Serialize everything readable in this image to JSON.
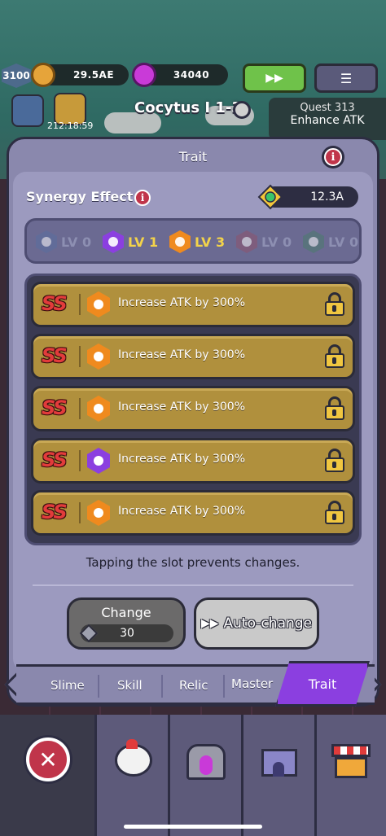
{
  "hud": {
    "level": "3100",
    "gold": "29.5AE",
    "gems": "34040",
    "timer": "212:18:59",
    "stage_title": "Cocytus I 1-3",
    "quest_title": "Quest 313",
    "quest_desc": "Enhance ATK"
  },
  "panel": {
    "title": "Trait",
    "synergy_label": "Synergy Effect",
    "synergy_value": "12.3A",
    "levels": [
      {
        "label": "LV 0",
        "color": "#5a6f9e",
        "active": false
      },
      {
        "label": "LV 1",
        "color": "#8b3fe0",
        "active": true
      },
      {
        "label": "LV 3",
        "color": "#ef8a1e",
        "active": true
      },
      {
        "label": "LV 0",
        "color": "#8a5570",
        "active": false
      },
      {
        "label": "LV 0",
        "color": "#4e7a70",
        "active": false
      }
    ],
    "slots": [
      {
        "grade": "SS",
        "text": "Increase ATK by 300%",
        "color": "#ef8a1e"
      },
      {
        "grade": "SS",
        "text": "Increase ATK by 300%",
        "color": "#ef8a1e"
      },
      {
        "grade": "SS",
        "text": "Increase ATK by 300%",
        "color": "#ef8a1e"
      },
      {
        "grade": "SS",
        "text": "Increase ATK by 300%",
        "color": "#8b3fe0"
      },
      {
        "grade": "SS",
        "text": "Increase ATK by 300%",
        "color": "#ef8a1e"
      }
    ],
    "hint": "Tapping the slot prevents changes.",
    "change_label": "Change",
    "change_cost": "30",
    "auto_change_label": "Auto-change"
  },
  "tabs": [
    "Slime",
    "Skill",
    "Relic",
    "Master",
    "Trait"
  ],
  "active_tab": "Trait"
}
